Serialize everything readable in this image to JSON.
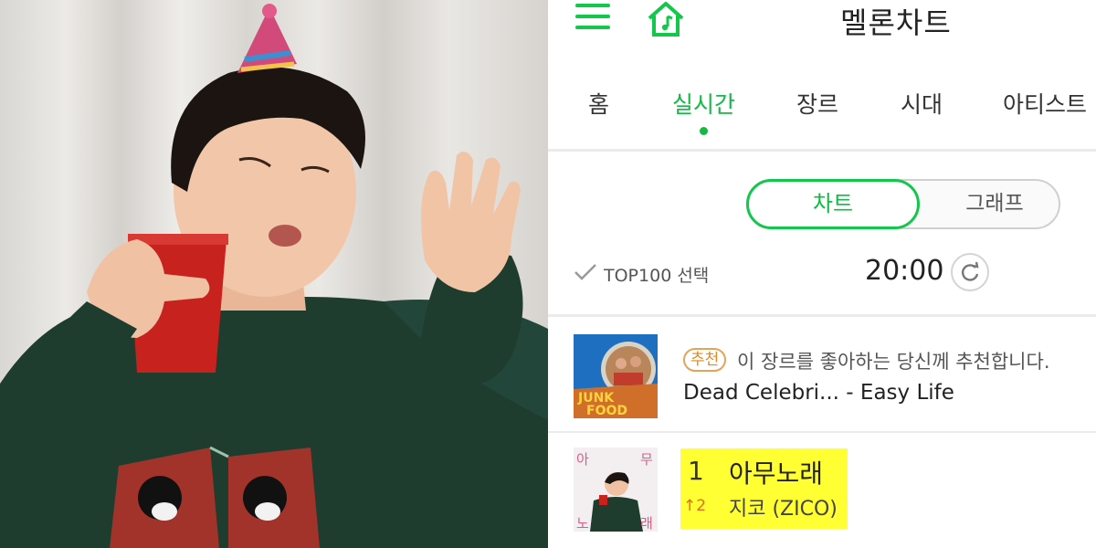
{
  "header": {
    "title": "멜론차트",
    "menu_icon": "hamburger-menu-icon",
    "home_icon": "music-home-icon"
  },
  "tabs": [
    {
      "label": "홈",
      "active": false
    },
    {
      "label": "실시간",
      "active": true
    },
    {
      "label": "장르",
      "active": false
    },
    {
      "label": "시대",
      "active": false
    },
    {
      "label": "아티스트",
      "active": false
    }
  ],
  "view_toggle": {
    "selected": "차트",
    "other": "그래프"
  },
  "top100": {
    "label": "TOP100 선택",
    "check_icon": "check-icon"
  },
  "time": {
    "value": "20:00",
    "refresh_icon": "refresh-icon"
  },
  "recommendation": {
    "badge": "추천",
    "text": "이 장르를 좋아하는 당신께 추천합니다.",
    "song": "Dead Celebri... - Easy Life",
    "album_art_text": [
      "JUNK",
      "FOOD"
    ]
  },
  "chart_entry": {
    "rank": "1",
    "rank_change": "↑2",
    "title": "아무노래",
    "artist": "지코 (ZICO)",
    "album_art_text": [
      "아",
      "무",
      "노",
      "래"
    ]
  },
  "colors": {
    "accent": "#13c74a",
    "highlight": "#ffff33",
    "badge": "#e38a1b"
  }
}
